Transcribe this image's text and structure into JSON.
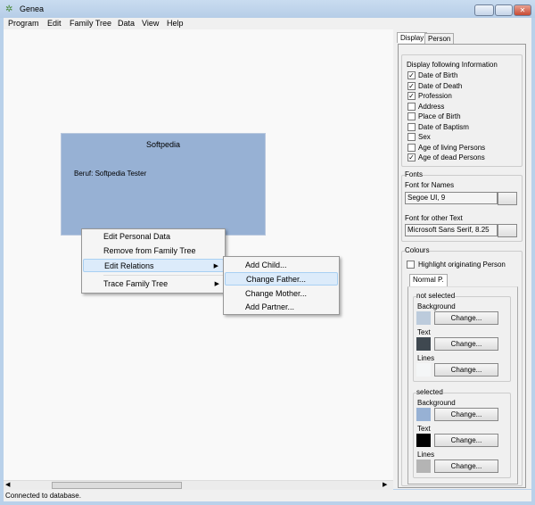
{
  "window": {
    "title": "Genea",
    "minimize": "–",
    "maximize": "□",
    "close": "✕"
  },
  "menubar": [
    "Program",
    "Edit",
    "Family Tree",
    "Data",
    "View",
    "Help"
  ],
  "person_card": {
    "name": "Softpedia",
    "profession": "Beruf: Softpedia Tester",
    "color": "#97b1d4"
  },
  "context_menu": {
    "items": [
      "Edit Personal Data",
      "Remove from Family Tree",
      "Edit Relations",
      "Trace Family Tree"
    ],
    "submenu": [
      "Add Child...",
      "Change Father...",
      "Change Mother...",
      "Add Partner..."
    ]
  },
  "panel": {
    "tabs": [
      "Display",
      "Person"
    ],
    "display_group": {
      "title": "Display following Information",
      "options": [
        {
          "label": "Date of Birth",
          "checked": true
        },
        {
          "label": "Date of Death",
          "checked": true
        },
        {
          "label": "Profession",
          "checked": true
        },
        {
          "label": "Address",
          "checked": false
        },
        {
          "label": "Place of Birth",
          "checked": false
        },
        {
          "label": "Date of Baptism",
          "checked": false
        },
        {
          "label": "Sex",
          "checked": false
        },
        {
          "label": "Age of living Persons",
          "checked": false
        },
        {
          "label": "Age of dead Persons",
          "checked": true
        }
      ]
    },
    "fonts": {
      "title": "Fonts",
      "names_label": "Font for Names",
      "names_value": "Segoe UI, 9",
      "other_label": "Font for other Text",
      "other_value": "Microsoft Sans Serif, 8.25"
    },
    "colours": {
      "title": "Colours",
      "highlight_label": "Highlight originating Person",
      "highlight_checked": false,
      "inner_tab": "Normal P.",
      "not_selected": {
        "title": "not selected",
        "background_label": "Background",
        "background": "#bccbdc",
        "text_label": "Text",
        "text": "#3f4850",
        "lines_label": "Lines",
        "lines": "#f4f6f7"
      },
      "selected": {
        "title": "selected",
        "background_label": "Background",
        "background": "#97b1d4",
        "text_label": "Text",
        "text": "#000000",
        "lines_label": "Lines",
        "lines": "#b4b4b4"
      },
      "change_label": "Change..."
    }
  },
  "status": "Connected to database."
}
